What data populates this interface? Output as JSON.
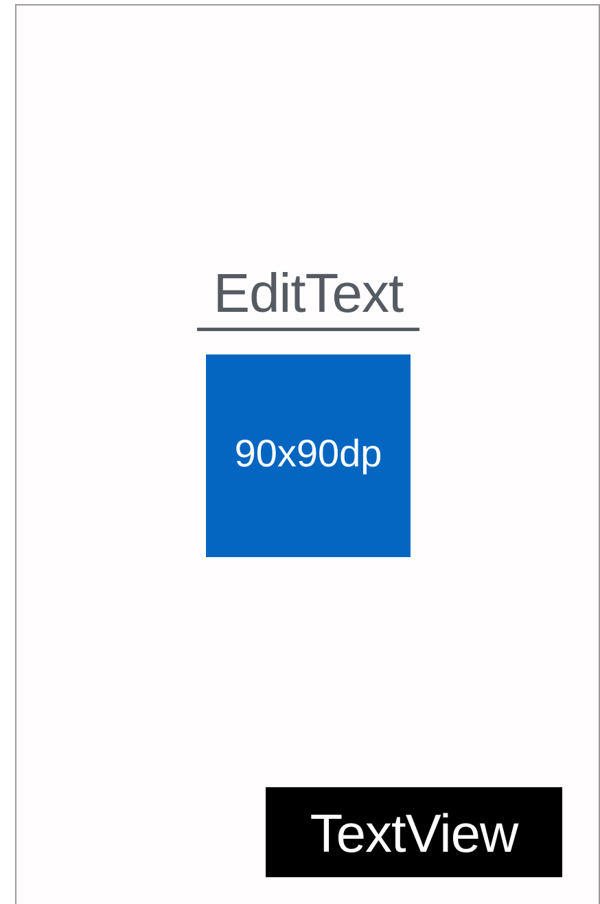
{
  "colors": {
    "frame_border": "#9a9a9a",
    "edit_text_color": "#565b63",
    "box_fill": "#0466c1",
    "text_view_background": "#000000",
    "text_view_color": "#ffffff"
  },
  "edit_text": {
    "value": "EditText"
  },
  "view_box": {
    "label": "90x90dp"
  },
  "text_view": {
    "label": "TextView"
  }
}
